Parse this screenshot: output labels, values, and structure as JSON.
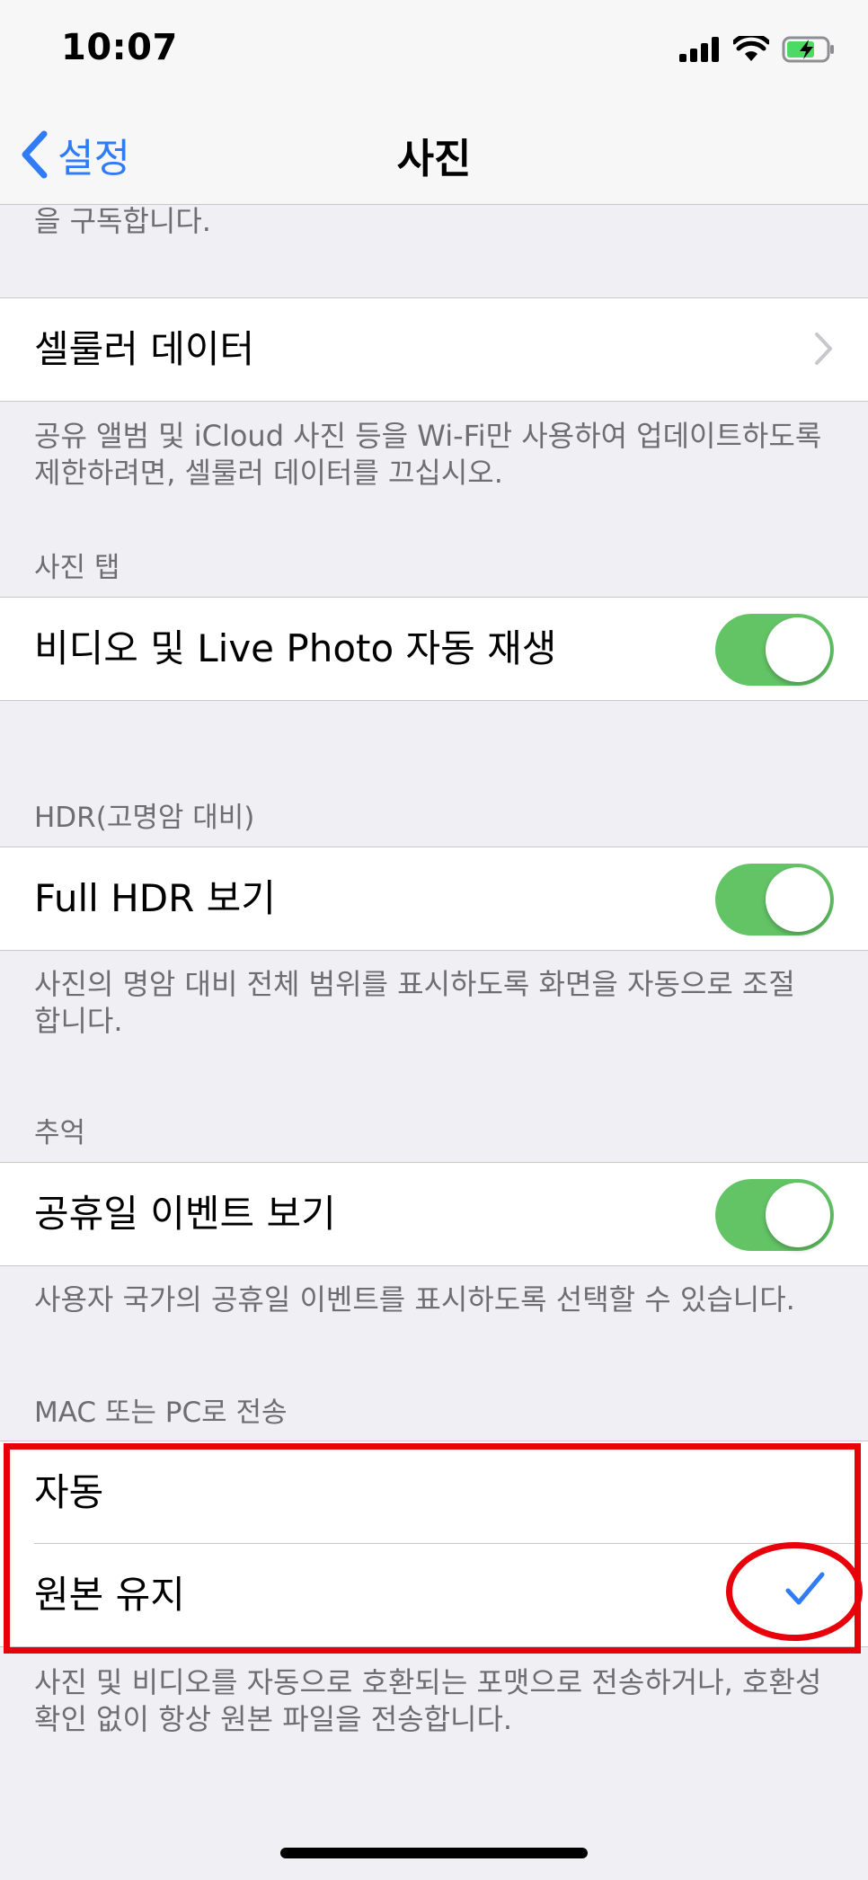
{
  "status": {
    "time": "10:07"
  },
  "nav": {
    "back_label": "설정",
    "title": "사진"
  },
  "sections": {
    "top_footer": "을 구독합니다.",
    "cellular": {
      "label": "셀룰러 데이터",
      "footer_line1": "공유 앨범 및 iCloud 사진 등을 Wi-Fi만 사용하여 업데이트하도록",
      "footer_line2": "제한하려면, 셀룰러 데이터를 끄십시오."
    },
    "photos_tab": {
      "header": "사진 탭",
      "autoplay_label": "비디오 및 Live Photo 자동 재생",
      "autoplay_on": true
    },
    "hdr": {
      "header": "HDR(고명암 대비)",
      "full_hdr_label": "Full HDR 보기",
      "full_hdr_on": true,
      "footer_line1": "사진의 명암 대비 전체 범위를 표시하도록 화면을 자동으로 조절",
      "footer_line2": "합니다."
    },
    "memories": {
      "header": "추억",
      "holiday_label": "공휴일 이벤트 보기",
      "holiday_on": true,
      "footer": "사용자 국가의 공휴일 이벤트를 표시하도록 선택할 수 있습니다."
    },
    "transfer": {
      "header": "MAC 또는 PC로 전송",
      "options": [
        {
          "label": "자동",
          "selected": false
        },
        {
          "label": "원본 유지",
          "selected": true
        }
      ],
      "footer_line1": "사진 및 비디오를 자동으로 호환되는 포맷으로 전송하거나, 호환성",
      "footer_line2": "확인 없이 항상 원본 파일을 전송합니다."
    }
  },
  "colors": {
    "accent": "#2f7cf6",
    "toggle_on": "#63c466",
    "annotation": "#e8000b"
  }
}
